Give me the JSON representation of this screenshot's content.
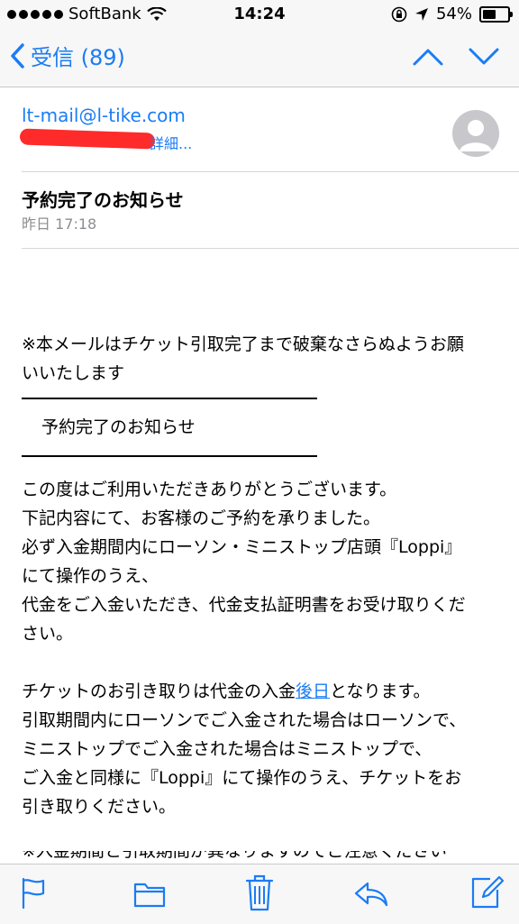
{
  "status_bar": {
    "carrier": "SoftBank",
    "time": "14:24",
    "battery": "54%",
    "battery_level": 0.54
  },
  "nav": {
    "back_label": "受信 (89)"
  },
  "header": {
    "sender": "lt-mail@l-tike.com",
    "details_label": "詳細...",
    "subject": "予約完了のお知らせ",
    "date": "昨日 17:18"
  },
  "body": {
    "notice_line1": "※本メールはチケット引取完了まで破棄なさらぬようお願",
    "notice_line2": "いいたします",
    "boxed_title": "予約完了のお知らせ",
    "para1": [
      "この度はご利用いただきありがとうございます。",
      "下記内容にて、お客様のご予約を承りました。",
      "必ず入金期間内にローソン・ミニストップ店頭『Loppi』",
      "にて操作のうえ、",
      "代金をご入金いただき、代金支払証明書をお受け取りくだ",
      "さい。"
    ],
    "para2_line1_before": "チケットのお引き取りは代金の入金",
    "para2_link": "後日",
    "para2_line1_after": "となります。",
    "para2": [
      "引取期間内にローソンでご入金された場合はローソンで、",
      "ミニストップでご入金された場合はミニストップで、",
      "ご入金と同様に『Loppi』にて操作のうえ、チケットをお",
      "引き取りください。"
    ],
    "para3_partial": "※入金期間と引取期間が異なりますのでご注意ください"
  },
  "colors": {
    "accent": "#1a7cf5",
    "redaction": "#ff2a2a"
  },
  "toolbar": {
    "icons": [
      "flag-icon",
      "folder-icon",
      "trash-icon",
      "reply-icon",
      "compose-icon"
    ]
  }
}
